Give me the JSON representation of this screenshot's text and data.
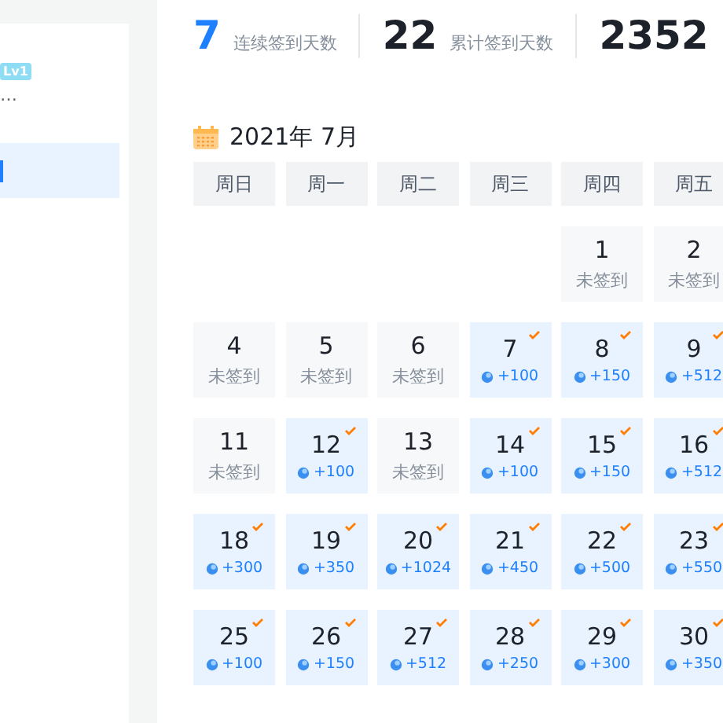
{
  "sidebar": {
    "badge": "Lv1",
    "user_text": "…",
    "items": [
      {
        "selected": true
      }
    ]
  },
  "stats": [
    {
      "value": "7",
      "label": "连续签到天数",
      "highlight": true
    },
    {
      "value": "22",
      "label": "累计签到天数",
      "highlight": false
    },
    {
      "value": "2352",
      "highlight": false
    }
  ],
  "calendar": {
    "title": "2021年 7月",
    "weekdays": [
      "周日",
      "周一",
      "周二",
      "周三",
      "周四",
      "周五"
    ],
    "weeks": [
      {
        "kind": "partial",
        "days": [
          {
            "day": "1",
            "signed": false,
            "status": "未签到"
          },
          {
            "day": "2",
            "signed": false,
            "status": "未签到"
          }
        ]
      },
      {
        "kind": "full",
        "days": [
          {
            "day": "4",
            "signed": false,
            "status": "未签到"
          },
          {
            "day": "5",
            "signed": false,
            "status": "未签到"
          },
          {
            "day": "6",
            "signed": false,
            "status": "未签到"
          },
          {
            "day": "7",
            "signed": true,
            "reward": "+100"
          },
          {
            "day": "8",
            "signed": true,
            "reward": "+150"
          },
          {
            "day": "9",
            "signed": true,
            "reward": "+512"
          }
        ]
      },
      {
        "kind": "full",
        "days": [
          {
            "day": "11",
            "signed": false,
            "status": "未签到"
          },
          {
            "day": "12",
            "signed": true,
            "reward": "+100"
          },
          {
            "day": "13",
            "signed": false,
            "status": "未签到"
          },
          {
            "day": "14",
            "signed": true,
            "reward": "+100"
          },
          {
            "day": "15",
            "signed": true,
            "reward": "+150"
          },
          {
            "day": "16",
            "signed": true,
            "reward": "+512"
          }
        ]
      },
      {
        "kind": "full",
        "days": [
          {
            "day": "18",
            "signed": true,
            "reward": "+300"
          },
          {
            "day": "19",
            "signed": true,
            "reward": "+350"
          },
          {
            "day": "20",
            "signed": true,
            "reward": "+1024"
          },
          {
            "day": "21",
            "signed": true,
            "reward": "+450"
          },
          {
            "day": "22",
            "signed": true,
            "reward": "+500"
          },
          {
            "day": "23",
            "signed": true,
            "reward": "+550"
          }
        ]
      },
      {
        "kind": "full",
        "days": [
          {
            "day": "25",
            "signed": true,
            "reward": "+100"
          },
          {
            "day": "26",
            "signed": true,
            "reward": "+150"
          },
          {
            "day": "27",
            "signed": true,
            "reward": "+512"
          },
          {
            "day": "28",
            "signed": true,
            "reward": "+250"
          },
          {
            "day": "29",
            "signed": true,
            "reward": "+300"
          },
          {
            "day": "30",
            "signed": true,
            "reward": "+350"
          }
        ]
      }
    ]
  }
}
